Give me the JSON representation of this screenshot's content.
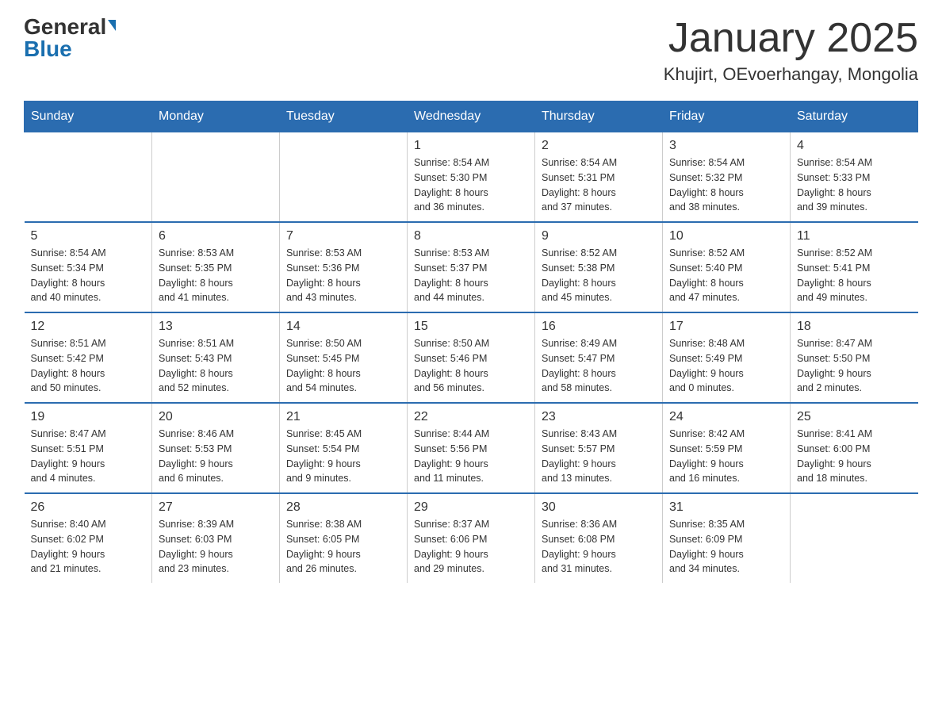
{
  "logo": {
    "general": "General",
    "blue": "Blue"
  },
  "calendar": {
    "title": "January 2025",
    "subtitle": "Khujirt, OEvoerhangay, Mongolia"
  },
  "weekdays": [
    "Sunday",
    "Monday",
    "Tuesday",
    "Wednesday",
    "Thursday",
    "Friday",
    "Saturday"
  ],
  "rows": [
    [
      {
        "day": "",
        "info": ""
      },
      {
        "day": "",
        "info": ""
      },
      {
        "day": "",
        "info": ""
      },
      {
        "day": "1",
        "info": "Sunrise: 8:54 AM\nSunset: 5:30 PM\nDaylight: 8 hours\nand 36 minutes."
      },
      {
        "day": "2",
        "info": "Sunrise: 8:54 AM\nSunset: 5:31 PM\nDaylight: 8 hours\nand 37 minutes."
      },
      {
        "day": "3",
        "info": "Sunrise: 8:54 AM\nSunset: 5:32 PM\nDaylight: 8 hours\nand 38 minutes."
      },
      {
        "day": "4",
        "info": "Sunrise: 8:54 AM\nSunset: 5:33 PM\nDaylight: 8 hours\nand 39 minutes."
      }
    ],
    [
      {
        "day": "5",
        "info": "Sunrise: 8:54 AM\nSunset: 5:34 PM\nDaylight: 8 hours\nand 40 minutes."
      },
      {
        "day": "6",
        "info": "Sunrise: 8:53 AM\nSunset: 5:35 PM\nDaylight: 8 hours\nand 41 minutes."
      },
      {
        "day": "7",
        "info": "Sunrise: 8:53 AM\nSunset: 5:36 PM\nDaylight: 8 hours\nand 43 minutes."
      },
      {
        "day": "8",
        "info": "Sunrise: 8:53 AM\nSunset: 5:37 PM\nDaylight: 8 hours\nand 44 minutes."
      },
      {
        "day": "9",
        "info": "Sunrise: 8:52 AM\nSunset: 5:38 PM\nDaylight: 8 hours\nand 45 minutes."
      },
      {
        "day": "10",
        "info": "Sunrise: 8:52 AM\nSunset: 5:40 PM\nDaylight: 8 hours\nand 47 minutes."
      },
      {
        "day": "11",
        "info": "Sunrise: 8:52 AM\nSunset: 5:41 PM\nDaylight: 8 hours\nand 49 minutes."
      }
    ],
    [
      {
        "day": "12",
        "info": "Sunrise: 8:51 AM\nSunset: 5:42 PM\nDaylight: 8 hours\nand 50 minutes."
      },
      {
        "day": "13",
        "info": "Sunrise: 8:51 AM\nSunset: 5:43 PM\nDaylight: 8 hours\nand 52 minutes."
      },
      {
        "day": "14",
        "info": "Sunrise: 8:50 AM\nSunset: 5:45 PM\nDaylight: 8 hours\nand 54 minutes."
      },
      {
        "day": "15",
        "info": "Sunrise: 8:50 AM\nSunset: 5:46 PM\nDaylight: 8 hours\nand 56 minutes."
      },
      {
        "day": "16",
        "info": "Sunrise: 8:49 AM\nSunset: 5:47 PM\nDaylight: 8 hours\nand 58 minutes."
      },
      {
        "day": "17",
        "info": "Sunrise: 8:48 AM\nSunset: 5:49 PM\nDaylight: 9 hours\nand 0 minutes."
      },
      {
        "day": "18",
        "info": "Sunrise: 8:47 AM\nSunset: 5:50 PM\nDaylight: 9 hours\nand 2 minutes."
      }
    ],
    [
      {
        "day": "19",
        "info": "Sunrise: 8:47 AM\nSunset: 5:51 PM\nDaylight: 9 hours\nand 4 minutes."
      },
      {
        "day": "20",
        "info": "Sunrise: 8:46 AM\nSunset: 5:53 PM\nDaylight: 9 hours\nand 6 minutes."
      },
      {
        "day": "21",
        "info": "Sunrise: 8:45 AM\nSunset: 5:54 PM\nDaylight: 9 hours\nand 9 minutes."
      },
      {
        "day": "22",
        "info": "Sunrise: 8:44 AM\nSunset: 5:56 PM\nDaylight: 9 hours\nand 11 minutes."
      },
      {
        "day": "23",
        "info": "Sunrise: 8:43 AM\nSunset: 5:57 PM\nDaylight: 9 hours\nand 13 minutes."
      },
      {
        "day": "24",
        "info": "Sunrise: 8:42 AM\nSunset: 5:59 PM\nDaylight: 9 hours\nand 16 minutes."
      },
      {
        "day": "25",
        "info": "Sunrise: 8:41 AM\nSunset: 6:00 PM\nDaylight: 9 hours\nand 18 minutes."
      }
    ],
    [
      {
        "day": "26",
        "info": "Sunrise: 8:40 AM\nSunset: 6:02 PM\nDaylight: 9 hours\nand 21 minutes."
      },
      {
        "day": "27",
        "info": "Sunrise: 8:39 AM\nSunset: 6:03 PM\nDaylight: 9 hours\nand 23 minutes."
      },
      {
        "day": "28",
        "info": "Sunrise: 8:38 AM\nSunset: 6:05 PM\nDaylight: 9 hours\nand 26 minutes."
      },
      {
        "day": "29",
        "info": "Sunrise: 8:37 AM\nSunset: 6:06 PM\nDaylight: 9 hours\nand 29 minutes."
      },
      {
        "day": "30",
        "info": "Sunrise: 8:36 AM\nSunset: 6:08 PM\nDaylight: 9 hours\nand 31 minutes."
      },
      {
        "day": "31",
        "info": "Sunrise: 8:35 AM\nSunset: 6:09 PM\nDaylight: 9 hours\nand 34 minutes."
      },
      {
        "day": "",
        "info": ""
      }
    ]
  ]
}
